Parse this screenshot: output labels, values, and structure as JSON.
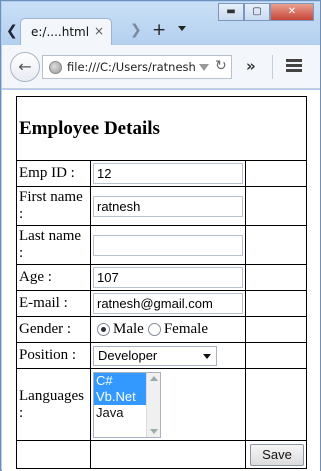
{
  "browser": {
    "tab_title": "e:/....html",
    "tab_close": "×",
    "address": "file:///C:/Users/ratnesh,",
    "overflow": "»",
    "window_controls": {
      "minimize": "▬",
      "maximize": "▢",
      "close": "✕"
    },
    "icons": [
      "chevron-left-icon",
      "close-icon",
      "chevron-right-icon",
      "plus-icon",
      "chevron-down-icon",
      "back-arrow-icon",
      "globe-icon",
      "reload-icon",
      "hamburger-menu-icon"
    ]
  },
  "form": {
    "title": "Employee Details",
    "fields": {
      "emp_id": {
        "label": "Emp ID :",
        "value": "12"
      },
      "first_name": {
        "label": "First name :",
        "value": "ratnesh"
      },
      "last_name": {
        "label": "Last name :",
        "value": ""
      },
      "age": {
        "label": "Age :",
        "value": "107"
      },
      "email": {
        "label": "E-mail :",
        "value": "ratnesh@gmail.com"
      }
    },
    "gender": {
      "label": "Gender :",
      "options": [
        "Male",
        "Female"
      ],
      "selected": "Male"
    },
    "position": {
      "label": "Position :",
      "value": "Developer"
    },
    "languages": {
      "label": "Languages :",
      "options": [
        "C#",
        "Vb.Net",
        "Java"
      ],
      "selected": [
        "C#",
        "Vb.Net"
      ]
    },
    "save_label": "Save"
  }
}
